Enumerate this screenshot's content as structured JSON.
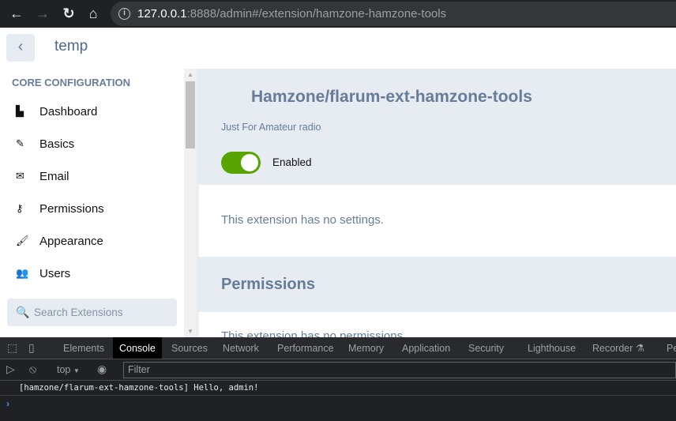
{
  "browser": {
    "url_host": "127.0.0.1",
    "url_rest": ":8888/admin#/extension/hamzone-hamzone-tools"
  },
  "header": {
    "back_label": "‹",
    "site_title": "temp"
  },
  "sidebar": {
    "heading": "CORE CONFIGURATION",
    "items": [
      {
        "label": "Dashboard",
        "icon": "chart-bar-icon"
      },
      {
        "label": "Basics",
        "icon": "pencil-icon"
      },
      {
        "label": "Email",
        "icon": "envelope-icon"
      },
      {
        "label": "Permissions",
        "icon": "key-icon"
      },
      {
        "label": "Appearance",
        "icon": "paint-brush-icon"
      },
      {
        "label": "Users",
        "icon": "users-icon"
      }
    ],
    "search_placeholder": "Search Extensions"
  },
  "extension": {
    "title": "Hamzone/flarum-ext-hamzone-tools",
    "description": "Just For Amateur radio",
    "enabled": true,
    "enabled_label": "Enabled",
    "no_settings": "This extension has no settings.",
    "permissions_title": "Permissions",
    "permissions_text": "This extension has no permissions."
  },
  "devtools": {
    "tabs": [
      "Elements",
      "Console",
      "Sources",
      "Network",
      "Performance",
      "Memory",
      "Application",
      "Security",
      "Lighthouse",
      "Recorder",
      "Pe"
    ],
    "active_tab": "Console",
    "context": "top",
    "filter_placeholder": "Filter",
    "log": "[hamzone/flarum-ext-hamzone-tools] Hello, admin!",
    "prompt": "›"
  },
  "colors": {
    "accent": "#667c99",
    "toggle_on": "#58a400",
    "band": "#e7ecf3"
  }
}
